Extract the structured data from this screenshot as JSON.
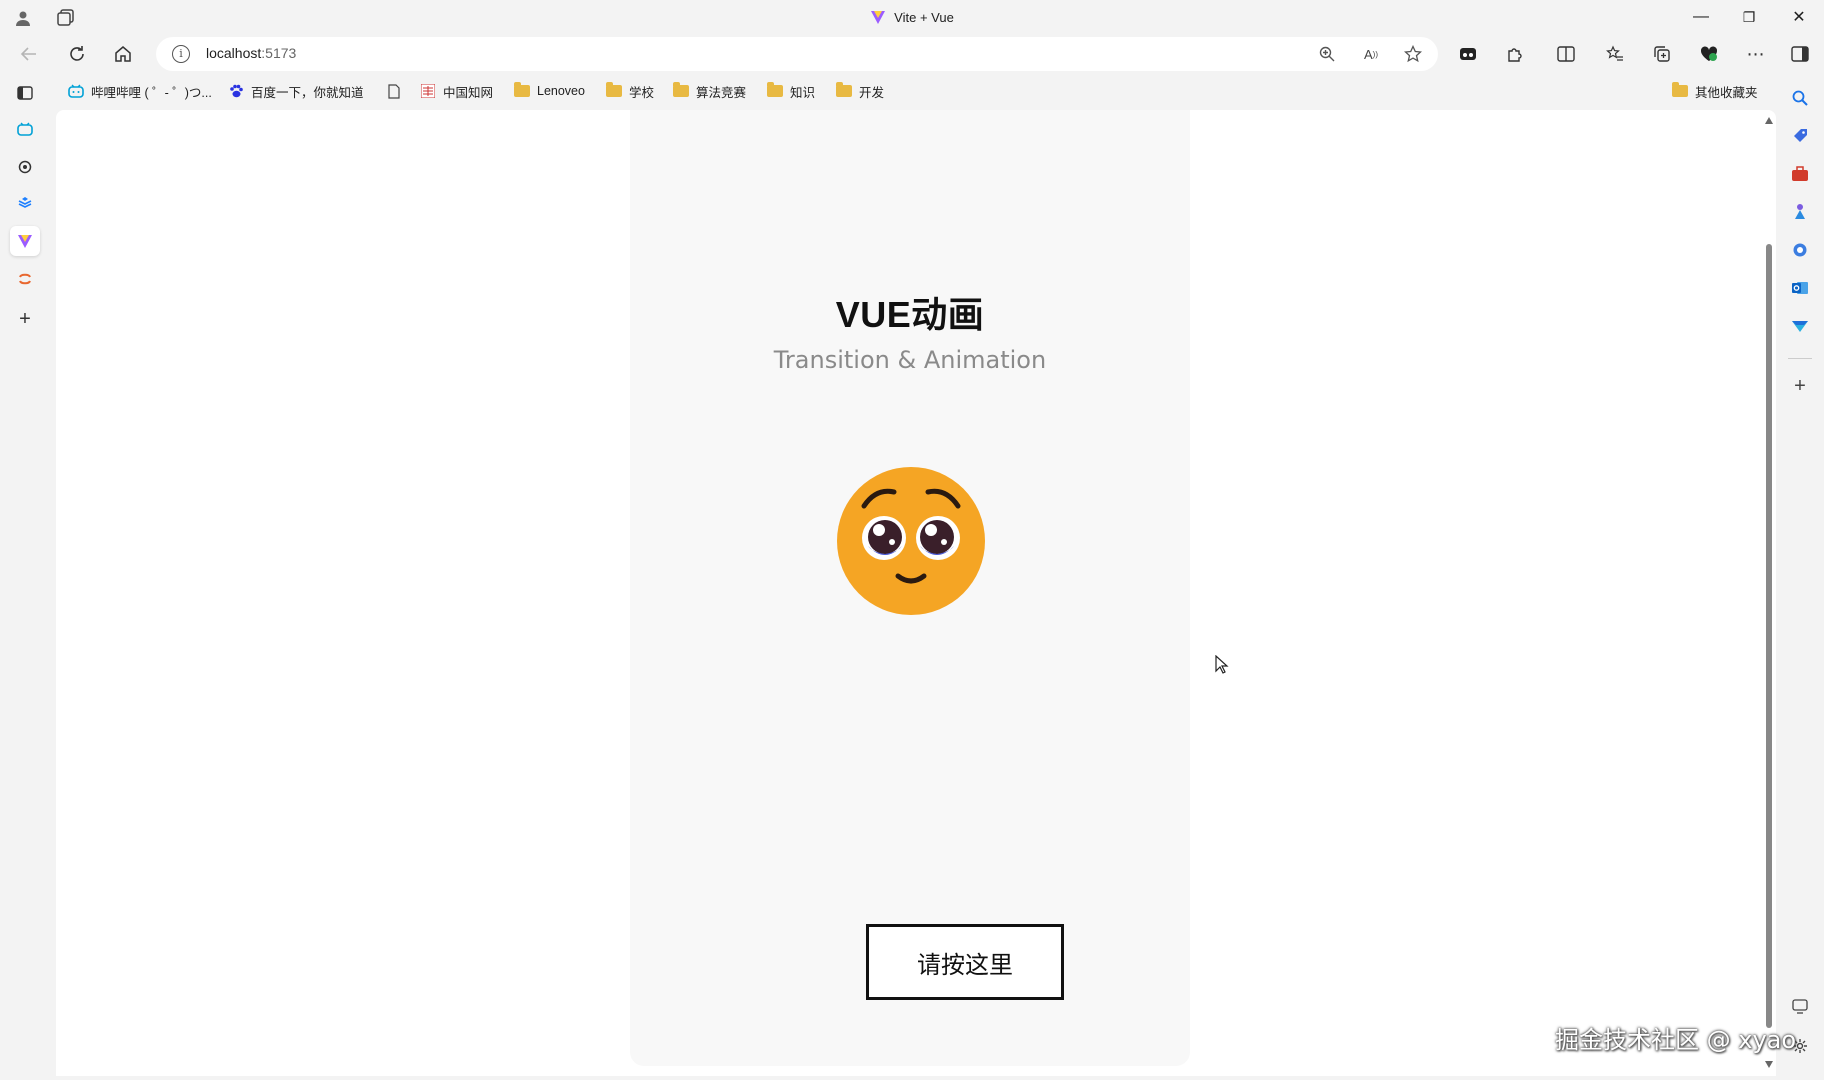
{
  "window": {
    "title": "Vite + Vue",
    "controls": {
      "minimize": "—",
      "restore": "❐",
      "close": "✕"
    }
  },
  "address_bar": {
    "host": "localhost",
    "port": ":5173"
  },
  "bookmarks": [
    {
      "label": "哔哩哔哩 ( ゜- ゜)つ...",
      "icon": "bilibili-icon"
    },
    {
      "label": "百度一下，你就知道",
      "icon": "baidu-icon"
    },
    {
      "label": "",
      "icon": "page-icon"
    },
    {
      "label": "中国知网",
      "icon": "cnki-icon"
    },
    {
      "label": "Lenoveo",
      "icon": "folder-icon"
    },
    {
      "label": "学校",
      "icon": "folder-icon"
    },
    {
      "label": "算法竞赛",
      "icon": "folder-icon"
    },
    {
      "label": "知识",
      "icon": "folder-icon"
    },
    {
      "label": "开发",
      "icon": "folder-icon"
    }
  ],
  "other_bookmarks": "其他收藏夹",
  "app": {
    "title": "VUE动画",
    "subtitle": "Transition & Animation",
    "button_label": "请按这里"
  },
  "colors": {
    "emoji_face": "#f5a524",
    "emoji_tear": "#4a5bd8",
    "card_bg": "#f8f8f8",
    "vue_green": "#42b883",
    "vite_purple": "#9b5cff"
  },
  "watermark": "掘金技术社区 @ xyao"
}
